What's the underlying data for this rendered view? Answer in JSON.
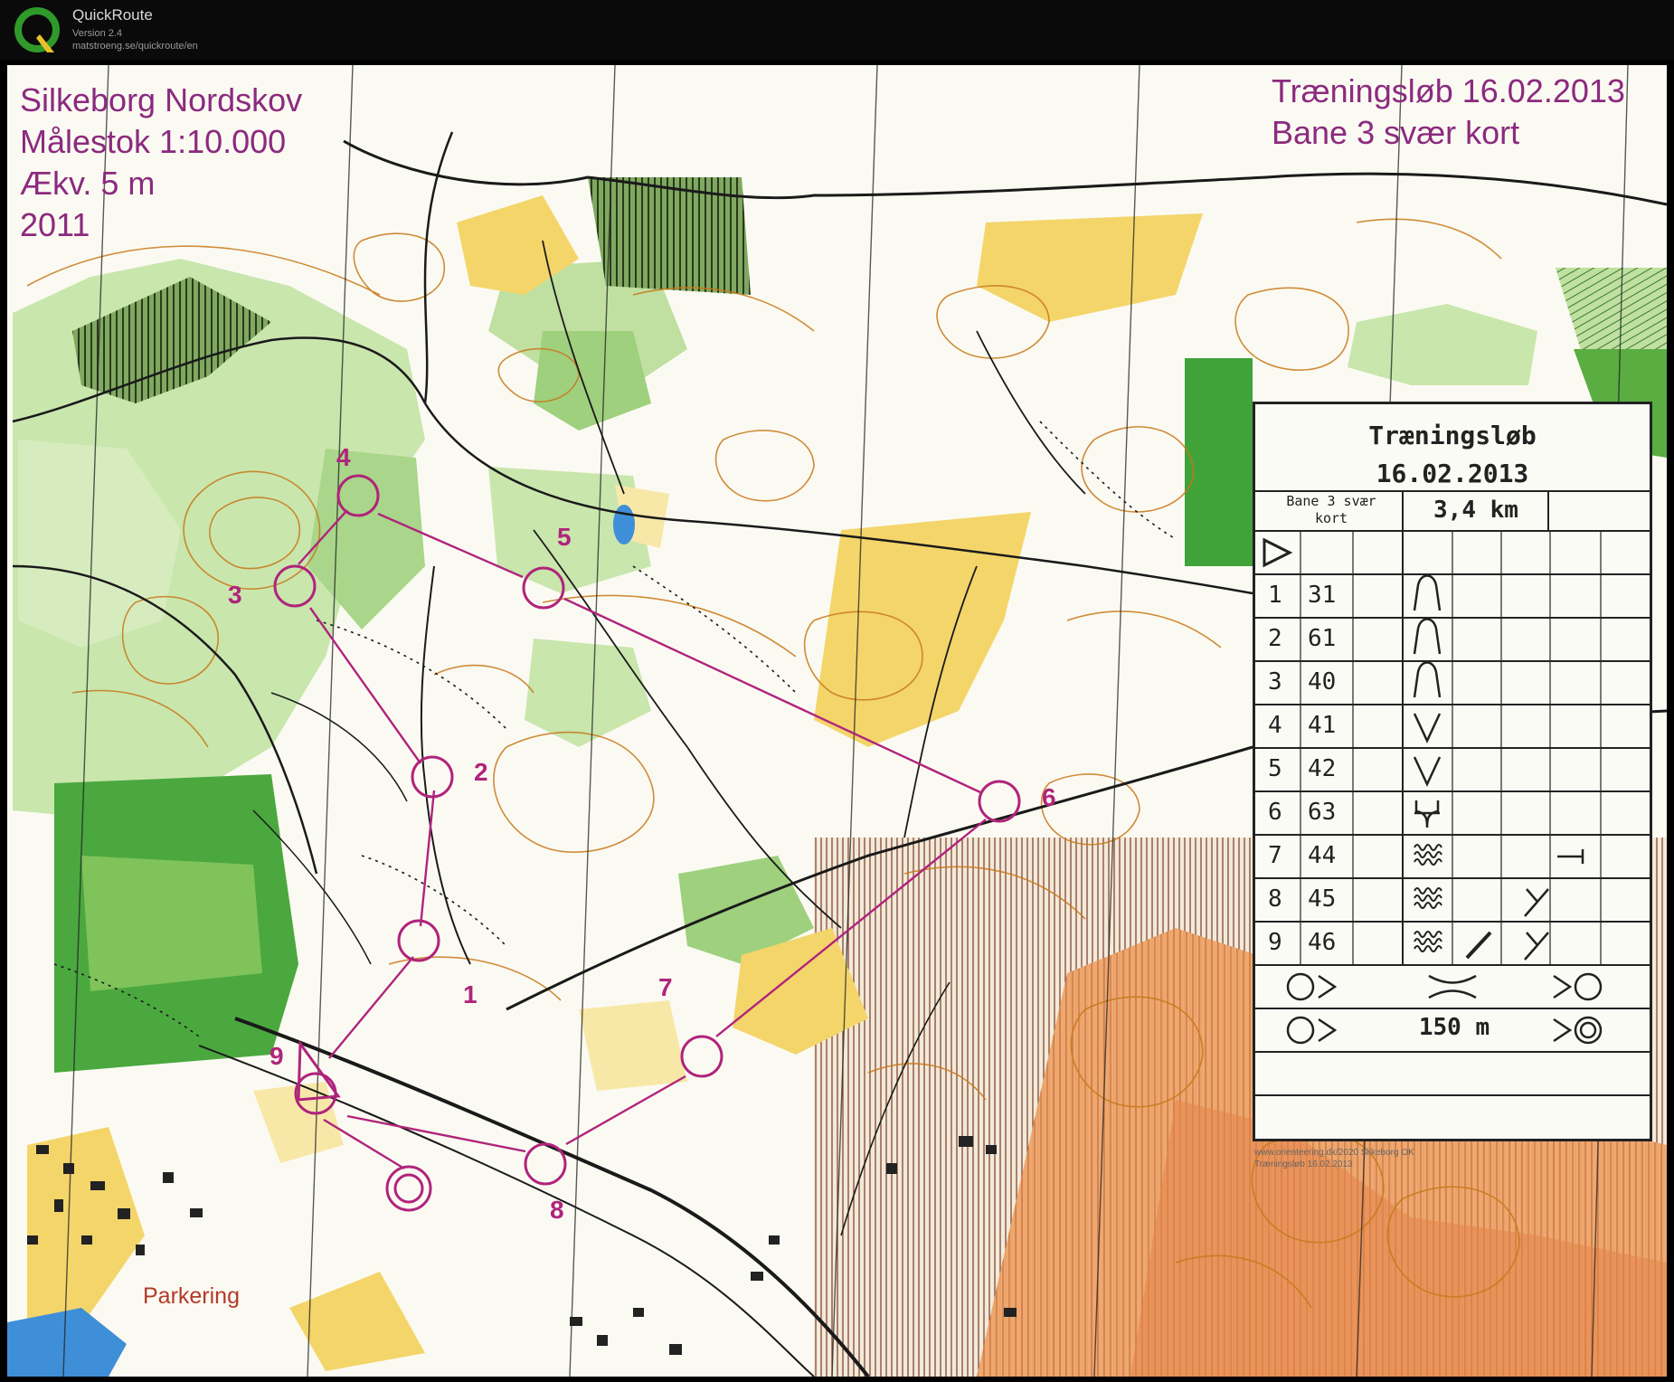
{
  "app": {
    "title": "QuickRoute",
    "version": "Version 2.4",
    "url": "matstroeng.se/quickroute/en"
  },
  "map": {
    "title_left": [
      "Silkeborg Nordskov",
      "Målestok 1:10.000",
      "Ækv. 5 m",
      "2011"
    ],
    "title_right": [
      "Træningsløb 16.02.2013",
      "Bane 3 svær kort"
    ],
    "parking_label": "Parkering",
    "copyright_lines": [
      "www.orienteering.dk/2020 Silkeborg OK",
      "Træningsløb 16.02.2013"
    ],
    "course_color": "#b0247c",
    "colors": {
      "open_land": "#f4d56a",
      "rough_open": "#f8e8a8",
      "green_light": "#bfe0a0",
      "green_medium": "#7fc35a",
      "green_dark": "#3fa33a",
      "contour": "#c8781a",
      "paper": "#fbfaf2",
      "urban_brown": "#e89a5a"
    }
  },
  "course": {
    "controls": [
      {
        "label": "1"
      },
      {
        "label": "2"
      },
      {
        "label": "3"
      },
      {
        "label": "4"
      },
      {
        "label": "5"
      },
      {
        "label": "6"
      },
      {
        "label": "7"
      },
      {
        "label": "8"
      },
      {
        "label": "9"
      }
    ]
  },
  "description": {
    "title_line1": "Træningsløb",
    "title_line2": "16.02.2013",
    "course_name": "Bane 3 svær kort",
    "course_name_line1": "Bane 3 svær",
    "course_name_line2": "kort",
    "length": "3,4 km",
    "start_symbol": "triangle",
    "rows": [
      {
        "num": "1",
        "code": "31",
        "feature": "knoll"
      },
      {
        "num": "2",
        "code": "61",
        "feature": "knoll"
      },
      {
        "num": "3",
        "code": "40",
        "feature": "knoll"
      },
      {
        "num": "4",
        "code": "41",
        "feature": "re-entrant"
      },
      {
        "num": "5",
        "code": "42",
        "feature": "re-entrant"
      },
      {
        "num": "6",
        "code": "63",
        "feature": "ditch-end"
      },
      {
        "num": "7",
        "code": "44",
        "feature": "thicket"
      },
      {
        "num": "8",
        "code": "45",
        "feature": "thicket"
      },
      {
        "num": "9",
        "code": "46",
        "feature": "thicket"
      }
    ],
    "finish_text": "150 m"
  }
}
